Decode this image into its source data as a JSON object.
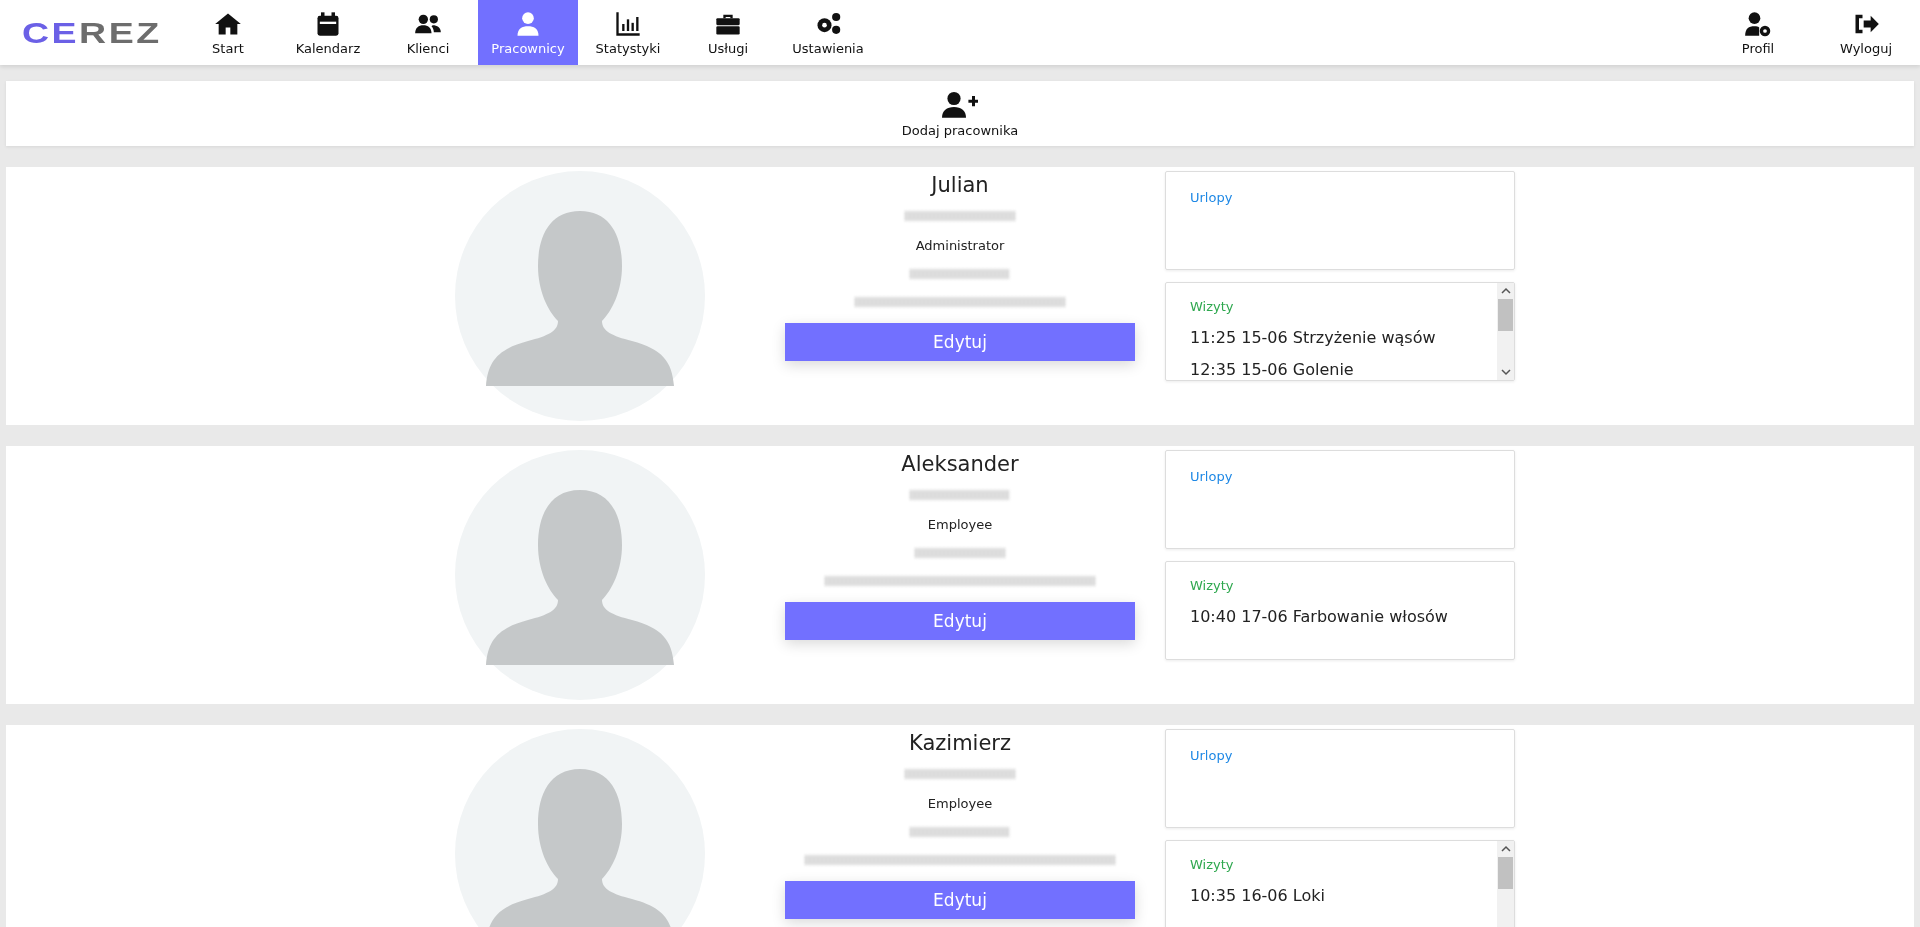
{
  "logo": {
    "text": "CEREZ"
  },
  "nav": [
    {
      "label": "Start",
      "selected": false
    },
    {
      "label": "Kalendarz",
      "selected": false
    },
    {
      "label": "Klienci",
      "selected": false
    },
    {
      "label": "Pracownicy",
      "selected": true
    },
    {
      "label": "Statystyki",
      "selected": false
    },
    {
      "label": "Usługi",
      "selected": false
    },
    {
      "label": "Ustawienia",
      "selected": false
    }
  ],
  "nav_right": [
    {
      "label": "Profil"
    },
    {
      "label": "Wyloguj"
    }
  ],
  "add_button": {
    "label": "Dodaj pracownika"
  },
  "employees": [
    {
      "name": "Julian",
      "role": "Administrator",
      "edit": "Edytuj",
      "leave": {
        "title": "Urlopy"
      },
      "visits": {
        "title": "Wizyty",
        "scrollable": true,
        "items": [
          "11:25 15-06 Strzyżenie wąsów",
          "12:35 15-06 Golenie"
        ]
      }
    },
    {
      "name": "Aleksander",
      "role": "Employee",
      "edit": "Edytuj",
      "leave": {
        "title": "Urlopy"
      },
      "visits": {
        "title": "Wizyty",
        "scrollable": false,
        "items": [
          "10:40 17-06 Farbowanie włosów"
        ]
      }
    },
    {
      "name": "Kazimierz",
      "role": "Employee",
      "edit": "Edytuj",
      "leave": {
        "title": "Urlopy"
      },
      "visits": {
        "title": "Wizyty",
        "scrollable": true,
        "items": [
          "10:35 16-06 Loki"
        ]
      }
    }
  ]
}
